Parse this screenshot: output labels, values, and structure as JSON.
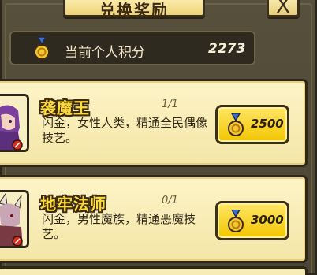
{
  "header": {
    "title": "兑换奖励",
    "close_symbol": "X"
  },
  "points": {
    "label": "当前个人积分",
    "value": "2273",
    "icon": "medal-icon"
  },
  "rewards": [
    {
      "name": "袭魔王",
      "count": "1/1",
      "description": "闪金，女性人类，精通全民偶像技艺。",
      "cost": "2500",
      "portrait": "demon-king-portrait"
    },
    {
      "name": "地牢法师",
      "count": "0/1",
      "description": "闪金，男性魔族，精通恶魔技艺。",
      "cost": "3000",
      "portrait": "dungeon-mage-portrait"
    }
  ],
  "colors": {
    "background": "#4a4434",
    "card": "#fdf4c7",
    "button": "#f2c500",
    "name_text": "#fcd93c"
  }
}
